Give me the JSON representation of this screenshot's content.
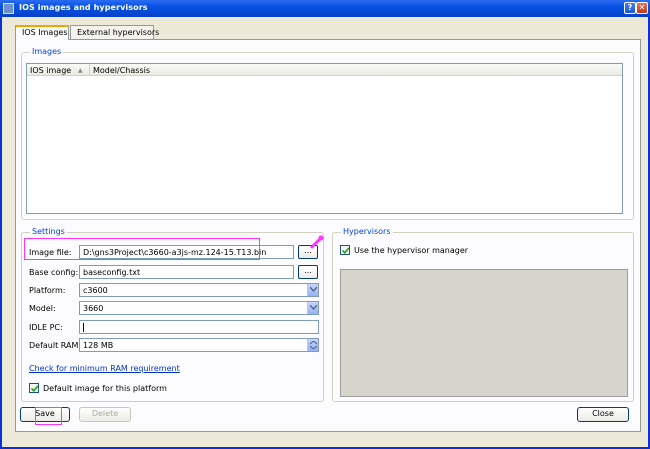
{
  "window": {
    "title": "IOS images and hypervisors",
    "help_glyph": "?",
    "close_glyph": "✕"
  },
  "tabs": [
    {
      "label": "IOS Images",
      "active": true
    },
    {
      "label": "External hypervisors",
      "active": false
    }
  ],
  "images": {
    "group_title": "Images",
    "columns": [
      "IOS image",
      "Model/Chassis"
    ],
    "sort_indicator": "▲",
    "rows": []
  },
  "settings": {
    "group_title": "Settings",
    "image_file_label": "Image file:",
    "image_file_value": "D:\\gns3Project\\c3660-a3js-mz.124-15.T13.bin",
    "base_config_label": "Base config:",
    "base_config_value": "baseconfig.txt",
    "platform_label": "Platform:",
    "platform_value": "c3600",
    "model_label": "Model:",
    "model_value": "3660",
    "idle_pc_label": "IDLE PC:",
    "idle_pc_value": "",
    "default_ram_label": "Default RAM:",
    "default_ram_value": "128 MB",
    "browse_label": "...",
    "ram_link": "Check for minimum RAM requirement",
    "default_image_label": "Default image for this platform",
    "default_image_checked": true
  },
  "hypervisors": {
    "group_title": "Hypervisors",
    "use_manager_label": "Use the hypervisor manager",
    "use_manager_checked": true
  },
  "buttons": {
    "save": "Save",
    "delete": "Delete",
    "close": "Close"
  },
  "colors": {
    "title_blue": "#0a54e3",
    "group_title": "#0046d5",
    "highlight": "#ff33ff",
    "link": "#0033cc"
  }
}
